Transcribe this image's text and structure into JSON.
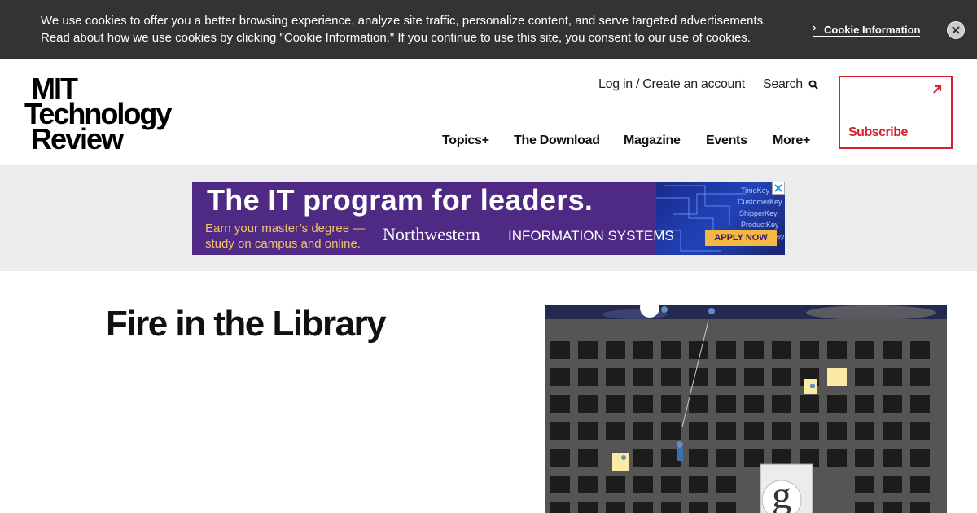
{
  "cookie": {
    "message": "We use cookies to offer you a better browsing experience, analyze site traffic, personalize content, and serve targeted advertisements. Read about how we use cookies by clicking \"Cookie Information.\" If you continue to use this site, you consent to our use of cookies.",
    "link_label": "Cookie Information",
    "close_icon": "close-icon"
  },
  "header": {
    "logo_lines": [
      "MIT",
      "Technology",
      "Review"
    ],
    "login_label": "Log in / Create an account",
    "search_label": "Search",
    "nav": [
      "Topics+",
      "The Download",
      "Magazine",
      "Events",
      "More+"
    ],
    "subscribe_label": "Subscribe"
  },
  "ad": {
    "headline": "The IT program for leaders.",
    "subline_1": "Earn your master’s degree —",
    "subline_2": "study on campus and online.",
    "brand": "Northwestern",
    "brand_unit": "INFORMATION SYSTEMS",
    "cta": "APPLY NOW",
    "art_labels": [
      "TimeKey",
      "CustomerKey",
      "ShipperKey",
      "ProductKey",
      "EmployeeKey"
    ]
  },
  "article": {
    "title": "Fire in the Library"
  },
  "colors": {
    "cookie_bg": "#333333",
    "accent_red": "#d6202c",
    "ad_purple": "#4f2a84",
    "ad_orange": "#f4b942"
  }
}
